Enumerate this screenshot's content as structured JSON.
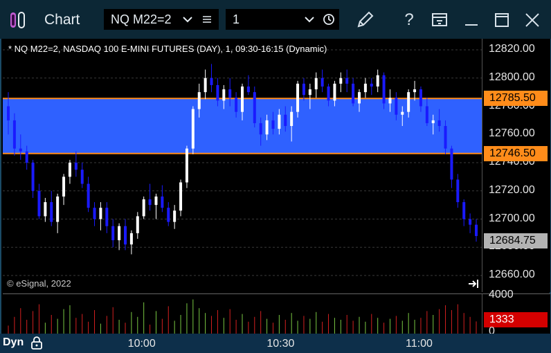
{
  "window": {
    "title": "Chart",
    "symbol_value": "NQ M22=2",
    "interval_value": "1",
    "icons": [
      "pencil-icon",
      "help-icon",
      "template-icon",
      "minimize-icon",
      "maximize-icon",
      "close-icon"
    ]
  },
  "chart": {
    "header": "* NQ M22=2, NASDAQ 100 E-MINI FUTURES (DAY), 1, 09:30-16:15 (Dynamic)",
    "copyright": "© eSignal, 2022",
    "price_labels": [
      "12820.00",
      "12800.00",
      "12780.00",
      "12760.00",
      "12740.00",
      "12720.00",
      "12700.00",
      "12680.00",
      "12660.00"
    ],
    "band_upper": "12785.50",
    "band_lower": "12746.50",
    "last_price": "12684.75",
    "volume_max": "4000",
    "volume_min": "0",
    "volume_last": "1333",
    "time_labels": [
      "10:00",
      "10:30",
      "11:00"
    ],
    "mode_label": "Dyn",
    "colors": {
      "band": "#2f61ff",
      "band_line": "#ff8c1a",
      "up_candle": "#ffffff",
      "down_candle": "#1a1aff",
      "last_tag": "#b3b3b3",
      "volume_tag": "#d40000"
    }
  },
  "chart_data": {
    "type": "candlestick",
    "ylim": [
      12655,
      12825
    ],
    "x_ticks": [
      "10:00",
      "10:30",
      "11:00"
    ],
    "bars": [
      [
        12780,
        12790,
        12760,
        12770
      ],
      [
        12770,
        12775,
        12745,
        12750
      ],
      [
        12750,
        12760,
        12742,
        12748
      ],
      [
        12748,
        12752,
        12735,
        12740
      ],
      [
        12740,
        12742,
        12715,
        12720
      ],
      [
        12720,
        12725,
        12700,
        12702
      ],
      [
        12702,
        12715,
        12698,
        12712
      ],
      [
        12712,
        12720,
        12695,
        12698
      ],
      [
        12698,
        12718,
        12690,
        12716
      ],
      [
        12716,
        12732,
        12710,
        12730
      ],
      [
        12730,
        12742,
        12725,
        12740
      ],
      [
        12740,
        12748,
        12730,
        12735
      ],
      [
        12735,
        12740,
        12722,
        12725
      ],
      [
        12725,
        12730,
        12705,
        12708
      ],
      [
        12708,
        12712,
        12695,
        12700
      ],
      [
        12700,
        12712,
        12692,
        12708
      ],
      [
        12708,
        12712,
        12690,
        12695
      ],
      [
        12695,
        12700,
        12680,
        12685
      ],
      [
        12685,
        12697,
        12678,
        12695
      ],
      [
        12695,
        12700,
        12678,
        12682
      ],
      [
        12682,
        12692,
        12675,
        12690
      ],
      [
        12690,
        12705,
        12686,
        12702
      ],
      [
        12702,
        12716,
        12700,
        12714
      ],
      [
        12714,
        12725,
        12706,
        12710
      ],
      [
        12710,
        12718,
        12700,
        12716
      ],
      [
        12716,
        12724,
        12705,
        12708
      ],
      [
        12708,
        12712,
        12695,
        12698
      ],
      [
        12698,
        12710,
        12693,
        12706
      ],
      [
        12706,
        12728,
        12702,
        12726
      ],
      [
        12726,
        12752,
        12722,
        12750
      ],
      [
        12750,
        12780,
        12746,
        12778
      ],
      [
        12778,
        12796,
        12772,
        12790
      ],
      [
        12790,
        12806,
        12785,
        12800
      ],
      [
        12800,
        12810,
        12790,
        12795
      ],
      [
        12795,
        12800,
        12780,
        12784
      ],
      [
        12784,
        12795,
        12778,
        12792
      ],
      [
        12792,
        12800,
        12780,
        12786
      ],
      [
        12786,
        12790,
        12772,
        12776
      ],
      [
        12776,
        12796,
        12770,
        12794
      ],
      [
        12794,
        12802,
        12788,
        12790
      ],
      [
        12790,
        12794,
        12765,
        12768
      ],
      [
        12768,
        12772,
        12752,
        12760
      ],
      [
        12760,
        12774,
        12756,
        12770
      ],
      [
        12770,
        12776,
        12760,
        12764
      ],
      [
        12764,
        12778,
        12760,
        12774
      ],
      [
        12774,
        12780,
        12762,
        12766
      ],
      [
        12766,
        12780,
        12755,
        12776
      ],
      [
        12776,
        12798,
        12772,
        12796
      ],
      [
        12796,
        12800,
        12784,
        12788
      ],
      [
        12788,
        12796,
        12778,
        12792
      ],
      [
        12792,
        12804,
        12786,
        12800
      ],
      [
        12800,
        12806,
        12790,
        12794
      ],
      [
        12794,
        12796,
        12780,
        12784
      ],
      [
        12784,
        12798,
        12780,
        12796
      ],
      [
        12796,
        12804,
        12790,
        12800
      ],
      [
        12800,
        12806,
        12790,
        12796
      ],
      [
        12796,
        12800,
        12780,
        12782
      ],
      [
        12782,
        12792,
        12776,
        12790
      ],
      [
        12790,
        12800,
        12786,
        12796
      ],
      [
        12796,
        12800,
        12788,
        12794
      ],
      [
        12794,
        12806,
        12790,
        12802
      ],
      [
        12802,
        12804,
        12778,
        12782
      ],
      [
        12782,
        12792,
        12776,
        12786
      ],
      [
        12786,
        12790,
        12770,
        12774
      ],
      [
        12774,
        12780,
        12766,
        12776
      ],
      [
        12776,
        12792,
        12772,
        12790
      ],
      [
        12790,
        12798,
        12784,
        12792
      ],
      [
        12792,
        12794,
        12776,
        12780
      ],
      [
        12780,
        12786,
        12766,
        12768
      ],
      [
        12768,
        12774,
        12760,
        12770
      ],
      [
        12770,
        12778,
        12762,
        12766
      ],
      [
        12766,
        12770,
        12746,
        12750
      ],
      [
        12750,
        12752,
        12722,
        12728
      ],
      [
        12728,
        12732,
        12708,
        12712
      ],
      [
        12712,
        12714,
        12695,
        12700
      ],
      [
        12700,
        12704,
        12690,
        12696
      ],
      [
        12696,
        12700,
        12684,
        12688
      ]
    ],
    "volume": {
      "max": 4000,
      "last": 1333,
      "values": [
        900,
        1800,
        2700,
        1500,
        2400,
        3100,
        1200,
        2000,
        1600,
        2600,
        3000,
        1700,
        2100,
        1300,
        2500,
        1100,
        1900,
        2800,
        1500,
        1200,
        2300,
        1800,
        3300,
        1000,
        2400,
        1600,
        2900,
        1400,
        2000,
        3200,
        3600,
        2700,
        2200,
        1900,
        2500,
        1700,
        2600,
        1500,
        2100,
        1300,
        1800,
        2400,
        1600,
        1200,
        2000,
        1500,
        2200,
        1400,
        1900,
        1600,
        2300,
        1300,
        2100,
        1700,
        1500,
        2000,
        1400,
        1800,
        1300,
        2100,
        1700,
        1200,
        1600,
        1900,
        1400,
        2200,
        1500,
        1700,
        2400,
        2000,
        2600,
        3000,
        2500,
        3100,
        2200,
        1800,
        1333
      ]
    }
  }
}
